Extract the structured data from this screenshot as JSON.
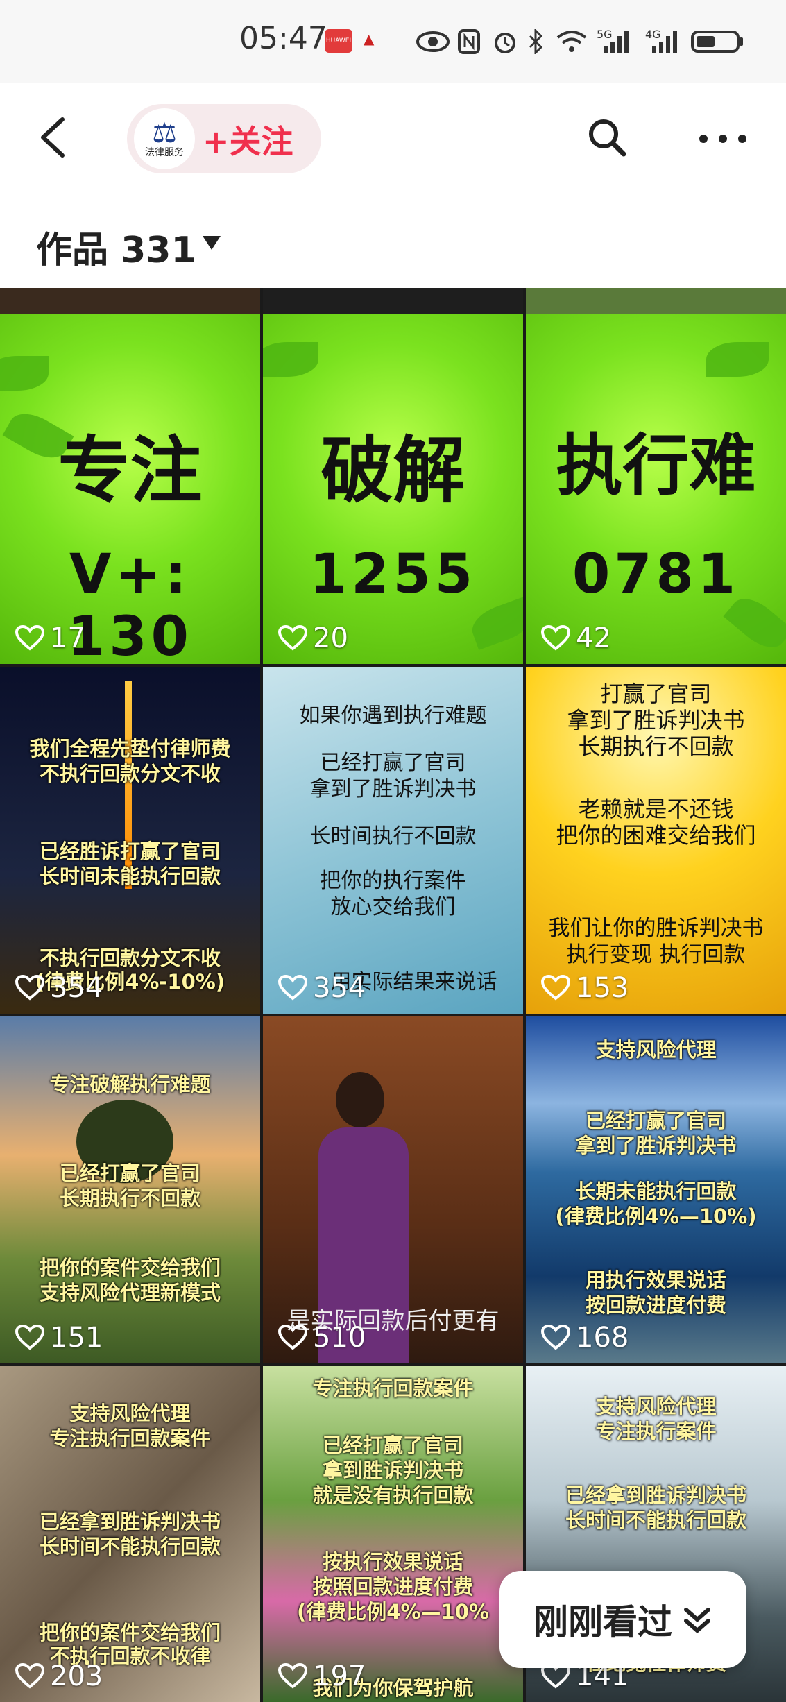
{
  "status_bar": {
    "time": "05:47",
    "signal_5g": "5G",
    "signal_4g": "4G"
  },
  "header": {
    "follow_label": "+关注",
    "logo_text": "法律服务"
  },
  "works": {
    "label": "作品 331"
  },
  "tiles": [
    {
      "likes": "17",
      "line1": "专注",
      "line2": "V+: 130"
    },
    {
      "likes": "20",
      "line1": "破解",
      "line2": "1255"
    },
    {
      "likes": "42",
      "line1": "执行难",
      "line2": "0781"
    },
    {
      "likes": "354",
      "lines": [
        "我们全程先垫付律师费",
        "不执行回款分文不收",
        "已经胜诉打赢了官司",
        "长时间未能执行回款",
        "不执行回款分文不收",
        "(律费比例4%-10%)"
      ]
    },
    {
      "likes": "354",
      "lines": [
        "如果你遇到执行难题",
        "已经打赢了官司",
        "拿到了胜诉判决书",
        "长时间执行不回款",
        "把你的执行案件",
        "放心交给我们",
        "用实际结果来说话"
      ]
    },
    {
      "likes": "153",
      "lines": [
        "打赢了官司",
        "拿到了胜诉判决书",
        "长期执行不回款",
        "老赖就是不还钱",
        "把你的困难交给我们",
        "我们让你的胜诉判决书",
        "执行变现    执行回款"
      ]
    },
    {
      "likes": "151",
      "lines": [
        "专注破解执行难题",
        "已经打赢了官司",
        "长期执行不回款",
        "把你的案件交给我们",
        "支持风险代理新模式"
      ]
    },
    {
      "likes": "510",
      "lines": [
        "是实际回款后付更有"
      ]
    },
    {
      "likes": "168",
      "lines": [
        "支持风险代理",
        "已经打赢了官司",
        "拿到了胜诉判决书",
        "长期未能执行回款",
        "(律费比例4%—10%)",
        "用执行效果说话",
        "按回款进度付费"
      ]
    },
    {
      "likes": "203",
      "lines": [
        "支持风险代理",
        "专注执行回款案件",
        "已经拿到胜诉判决书",
        "长时间不能执行回款",
        "把你的案件交给我们",
        "不执行回款不收律"
      ]
    },
    {
      "likes": "197",
      "lines": [
        "专注执行回款案件",
        "已经打赢了官司",
        "拿到胜诉判决书",
        "就是没有执行回款",
        "按执行效果说话",
        "按照回款进度付费",
        "(律费比例4%—10%",
        "我们为你保驾护航"
      ]
    },
    {
      "likes": "141",
      "lines": [
        "支持风险代理",
        "专注执行案件",
        "已经拿到胜诉判决书",
        "长时间不能执行回款",
        "杜绝冤枉律师费"
      ]
    }
  ],
  "recently_viewed": {
    "label": "刚刚看过"
  },
  "colors": {
    "follow": "#f0304d",
    "accent_green": "#7be21f"
  }
}
